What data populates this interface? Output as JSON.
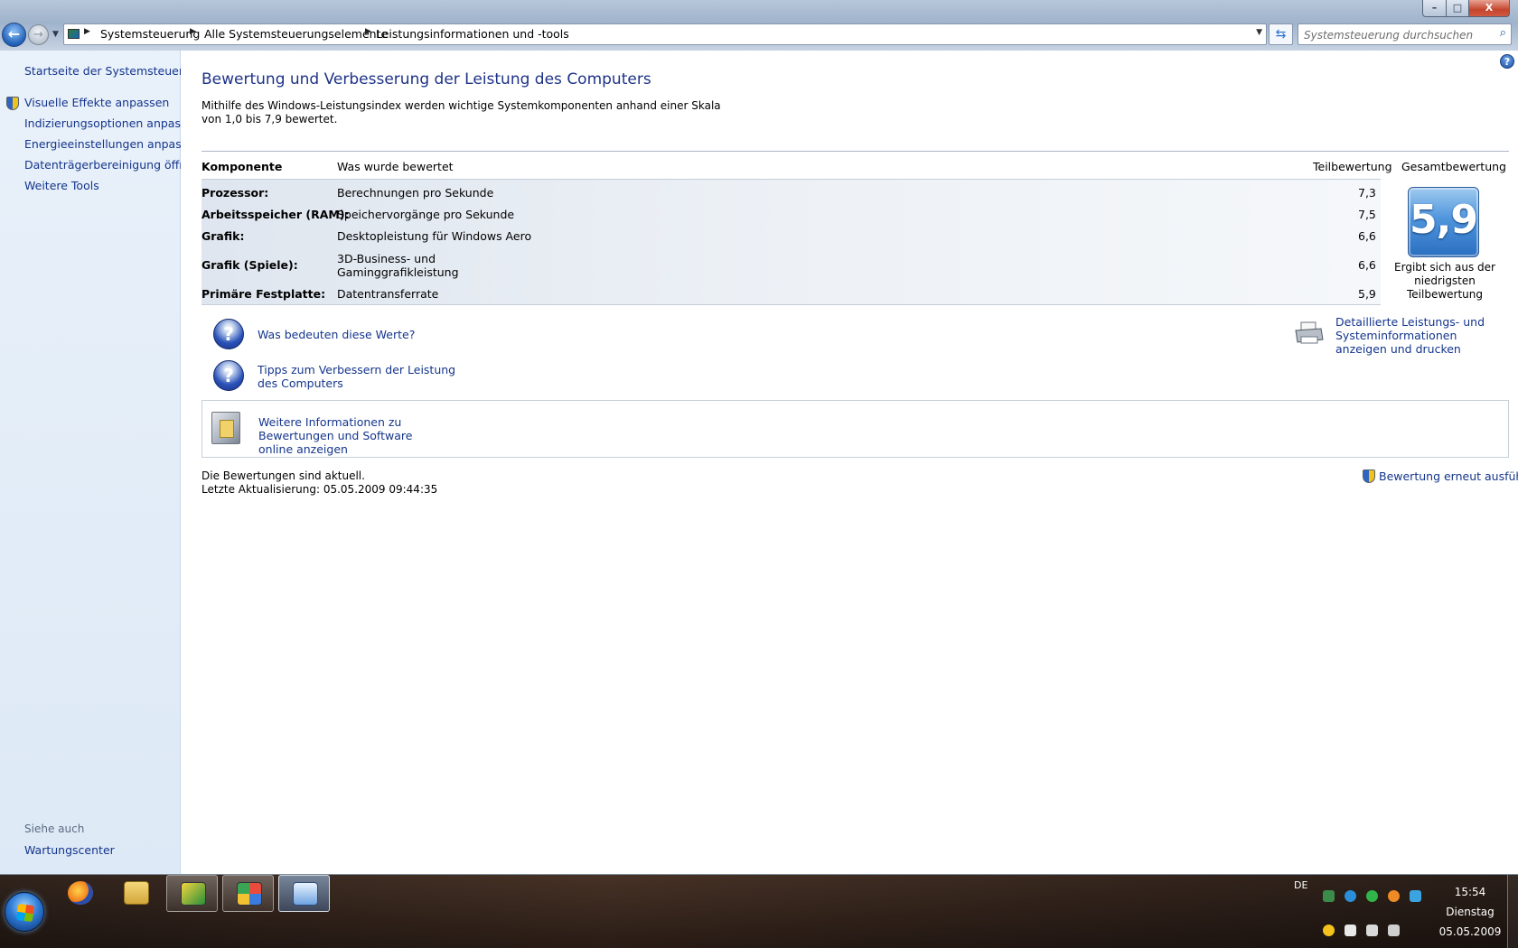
{
  "window": {
    "minimize_label": "–",
    "maximize_label": "□",
    "close_label": "X"
  },
  "address": {
    "breadcrumbs": [
      "Systemsteuerung",
      "Alle Systemsteuerungselemente",
      "Leistungsinformationen und -tools"
    ],
    "search_placeholder": "Systemsteuerung durchsuchen"
  },
  "sidebar": {
    "items": [
      {
        "label": "Startseite der Systemsteuerung"
      },
      {
        "label": "Visuelle Effekte anpassen"
      },
      {
        "label": "Indizierungsoptionen anpassen"
      },
      {
        "label": "Energieeinstellungen anpassen"
      },
      {
        "label": "Datenträgerbereinigung öffnen"
      },
      {
        "label": "Weitere Tools"
      }
    ],
    "see_also_label": "Siehe auch",
    "see_also_items": [
      {
        "label": "Wartungscenter"
      }
    ]
  },
  "main": {
    "title": "Bewertung und Verbesserung der Leistung des Computers",
    "intro": "Mithilfe des Windows-Leistungsindex werden wichtige Systemkomponenten anhand einer Skala von 1,0 bis 7,9 bewertet.",
    "table": {
      "headers": {
        "component": "Komponente",
        "rated": "Was wurde bewertet",
        "subscore": "Teilbewertung",
        "basescore": "Gesamtbewertung"
      },
      "rows": [
        {
          "component": "Prozessor:",
          "description": "Berechnungen pro Sekunde",
          "score": "7,3"
        },
        {
          "component": "Arbeitsspeicher (RAM):",
          "description": "Speichervorgänge pro Sekunde",
          "score": "7,5"
        },
        {
          "component": "Grafik:",
          "description": "Desktopleistung für Windows Aero",
          "score": "6,6"
        },
        {
          "component": "Grafik (Spiele):",
          "description": "3D-Business- und Gaminggrafikleistung",
          "score": "6,6"
        },
        {
          "component": "Primäre Festplatte:",
          "description": "Datentransferrate",
          "score": "5,9"
        }
      ],
      "base_score": "5,9",
      "base_score_caption": "Ergibt sich aus der niedrigsten Teilbewertung"
    },
    "links": {
      "what_mean": "Was bedeuten diese Werte?",
      "tips": "Tipps zum Verbessern der Leistung des Computers",
      "details": "Detaillierte Leistungs- und Systeminformationen anzeigen und drucken",
      "online": "Weitere Informationen zu Bewertungen und Software online anzeigen",
      "rerun": "Bewertung erneut ausführen"
    },
    "status": {
      "current": "Die Bewertungen sind aktuell.",
      "last_update": "Letzte Aktualisierung: 05.05.2009 09:44:35"
    }
  },
  "taskbar": {
    "language": "DE",
    "time": "15:54",
    "day": "Dienstag",
    "date": "05.05.2009"
  },
  "colors": {
    "link": "#14358c",
    "title": "#1e3287",
    "sidebar_bg": "#e3edf8"
  }
}
